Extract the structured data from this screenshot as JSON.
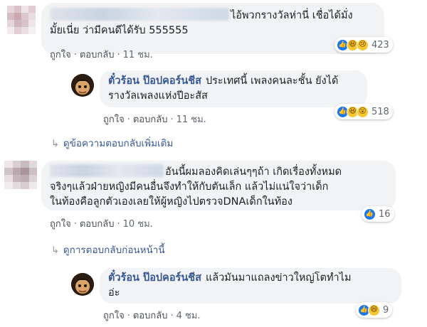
{
  "comments": [
    {
      "id": "c1",
      "text": "ไอ้พวกรางวัลห่านี่ เชื่อได้มั่ง",
      "text2": "มั้ยเนี่ย ว่ามีคนดีได้รับ 555555",
      "actions": {
        "like": "ถูกใจ",
        "reply": "ตอบกลับ",
        "time": "11 ชม."
      },
      "reactions": {
        "icons": [
          "like-icon",
          "haha-icon",
          "sad-icon"
        ],
        "count": "423"
      }
    },
    {
      "id": "r1",
      "author": "ตั๋วร้อน ป๊อปคอร์นชีส",
      "text": "ประเทศนี้ เพลงคนละชั้น ยังได้",
      "text2": "รางวัลเพลงแห่งปีอะสัส",
      "actions": {
        "like": "ถูกใจ",
        "reply": "ตอบกลับ",
        "time": "11 ชม."
      },
      "reactions": {
        "icons": [
          "like-icon",
          "haha-icon",
          "wow-icon"
        ],
        "count": "518"
      }
    },
    {
      "id": "c2",
      "text": "อันนี้ผมลองคิดเล่นๆๆถ้า เกิดเรื่องทั้งหมด",
      "text2": "จริงๆแล้วฝ่ายหญิงมีคนอื่นจึงทำให้กับตันเล็ก แล้วไม่แน่ใจว่าเด็ก",
      "text3": "ในท้องคือลูกตัวเองเลยให้ผู้หญิงไปตรวจDNAเด็กในท้อง",
      "actions": {
        "like": "ถูกใจ",
        "reply": "ตอบกลับ",
        "time": "10 ชม."
      },
      "reactions": {
        "icons": [
          "like-icon"
        ],
        "count": "16"
      }
    },
    {
      "id": "r2",
      "author": "ตั๋วร้อน ป๊อปคอร์นชีส",
      "text": "แล้วมันมาแถลงข่าวใหญ่โตทำไม",
      "text2": "อ่ะ",
      "actions": {
        "like": "ถูกใจ",
        "reply": "ตอบกลับ",
        "time": "4 ชม."
      },
      "reactions": {
        "icons": [
          "like-icon",
          "haha-icon"
        ],
        "count": "9"
      }
    }
  ],
  "links": {
    "more_replies": "ดูข้อความตอบกลับเพิ่มเติม",
    "previous_replies": "ดูการตอบกลับก่อนหน้านี้"
  },
  "separator": "·",
  "colors": {
    "link": "#385898",
    "bubble": "#f2f3f5",
    "like": "#1877f2",
    "emoji": "#f7c731"
  }
}
